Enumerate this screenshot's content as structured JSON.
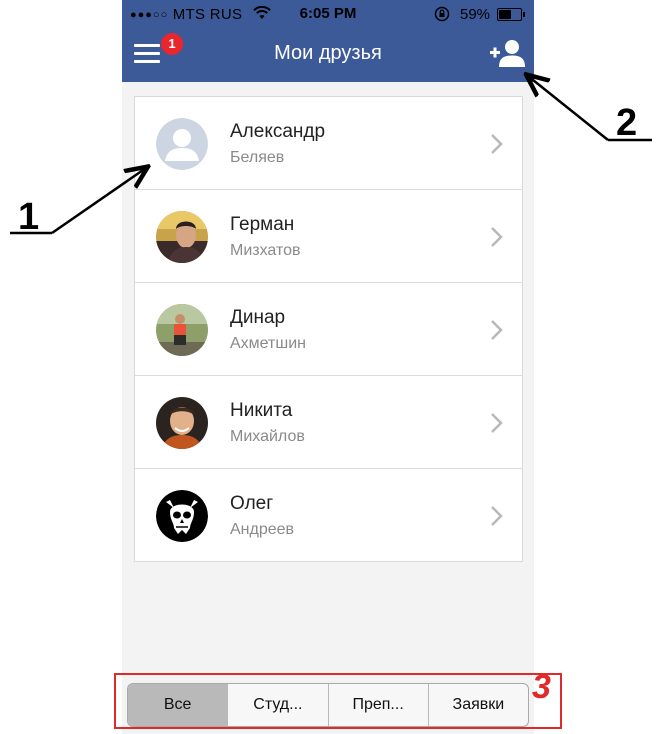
{
  "status_bar": {
    "carrier": "MTS RUS",
    "time": "6:05 PM",
    "battery": "59%"
  },
  "navbar": {
    "title": "Мои друзья",
    "badge_count": "1",
    "menu_icon": "hamburger-menu-icon",
    "add_icon": "add-friend-icon",
    "color": "#3d5a98"
  },
  "friends": [
    {
      "first": "Александр",
      "last": "Беляев",
      "avatar": "default-avatar-placeholder"
    },
    {
      "first": "Герман",
      "last": "Мизхатов",
      "avatar": "photo"
    },
    {
      "first": "Динар",
      "last": "Ахметшин",
      "avatar": "photo"
    },
    {
      "first": "Никита",
      "last": "Михайлов",
      "avatar": "photo"
    },
    {
      "first": "Олег",
      "last": "Андреев",
      "avatar": "skull-photo"
    }
  ],
  "segments": [
    {
      "label": "Все",
      "active": true
    },
    {
      "label": "Студ...",
      "active": false
    },
    {
      "label": "Преп...",
      "active": false
    },
    {
      "label": "Заявки",
      "active": false
    }
  ],
  "annotations": {
    "label_1": "1",
    "label_2": "2",
    "label_3": "3"
  }
}
